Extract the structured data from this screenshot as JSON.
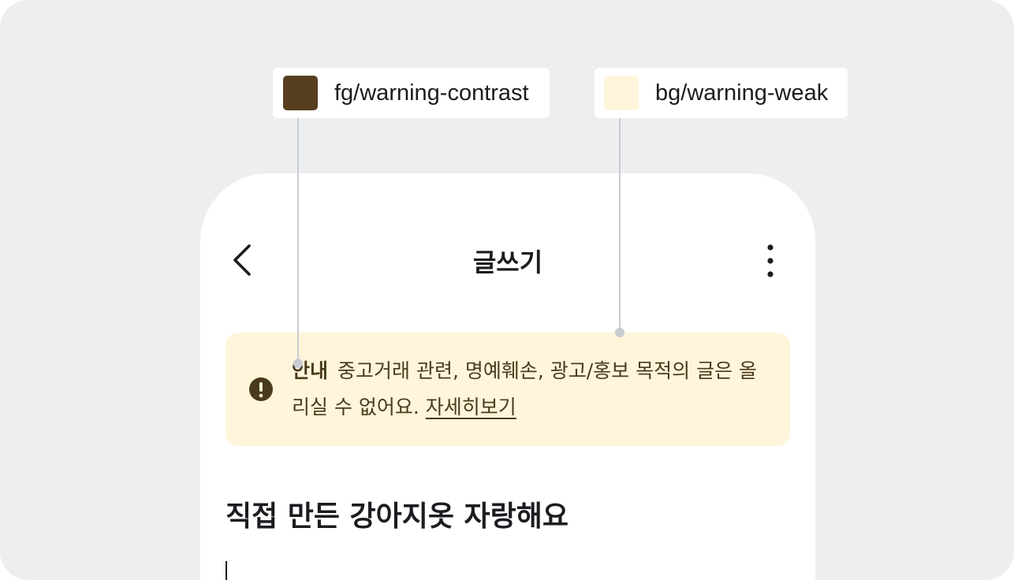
{
  "annotations": {
    "fg": {
      "label": "fg/warning-contrast",
      "color": "#563e1f"
    },
    "bg": {
      "label": "bg/warning-weak",
      "color": "#fff5db"
    }
  },
  "header": {
    "title": "글쓰기",
    "back_icon": "chevron-left-icon",
    "more_icon": "more-vertical-icon"
  },
  "banner": {
    "icon": "exclamation-circle-icon",
    "label": "안내",
    "message": "중고거래 관련, 명예훼손, 광고/홍보 목적의 글은 올리실 수 없어요.",
    "link": "자세히보기"
  },
  "post": {
    "title": "직접 만든 강아지옷 자랑해요",
    "body": ""
  },
  "colors": {
    "canvas": "#edeef0",
    "text_primary": "#1a1c20",
    "warning_fg": "#563e1f",
    "warning_bg": "#fff5db",
    "leader": "#c9ccd1"
  }
}
